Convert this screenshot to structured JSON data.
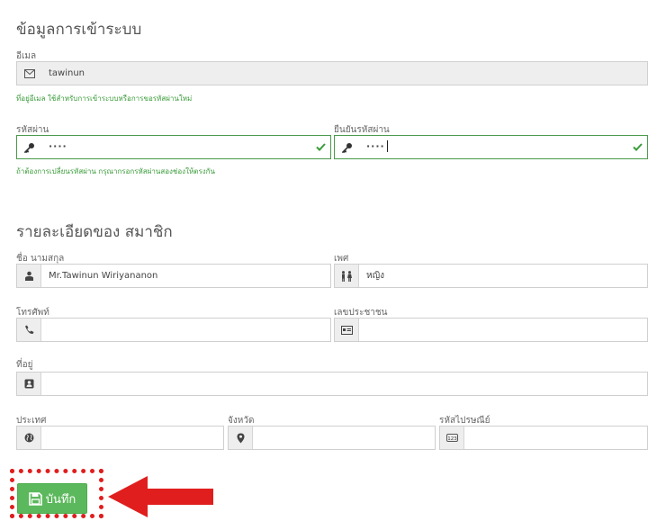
{
  "login_section": {
    "title": "ข้อมูลการเข้าระบบ",
    "email_label": "อีเมล",
    "email_value": "tawinun",
    "email_help": "ที่อยู่อีเมล ใช้สำหรับการเข้าระบบหรือการขอรหัสผ่านใหม่",
    "password_label": "รหัสผ่าน",
    "password_value": "····",
    "confirm_label": "ยืนยันรหัสผ่าน",
    "confirm_value": "····",
    "password_help": "ถ้าต้องการเปลี่ยนรหัสผ่าน กรุณากรอกรหัสผ่านสองช่องให้ตรงกัน"
  },
  "member_section": {
    "title": "รายละเอียดของ สมาชิก",
    "name_label": "ชื่อ นามสกุล",
    "name_value": "Mr.Tawinun Wiriyananon",
    "gender_label": "เพศ",
    "gender_value": "หญิง",
    "phone_label": "โทรศัพท์",
    "phone_value": "",
    "id_label": "เลขประชาชน",
    "id_value": "",
    "address_label": "ที่อยู่",
    "address_value": "",
    "country_label": "ประเทศ",
    "country_value": "",
    "province_label": "จังหวัด",
    "province_value": "",
    "zip_label": "รหัสไปรษณีย์",
    "zip_value": ""
  },
  "actions": {
    "save_label": "บันทึก"
  },
  "colors": {
    "success_green": "#5cb85c",
    "help_green": "#3a9c3a",
    "annotation_red": "#e01e1e"
  },
  "icons": {
    "email": "envelope-icon",
    "password": "key-icon",
    "valid": "check-icon",
    "name": "user-icon",
    "gender": "male-female-icon",
    "phone": "phone-icon",
    "id": "id-card-icon",
    "address": "address-book-icon",
    "country": "globe-icon",
    "province": "map-marker-icon",
    "zip": "zip-badge-icon",
    "save": "floppy-disk-icon",
    "annotation": "arrow-left-icon"
  }
}
